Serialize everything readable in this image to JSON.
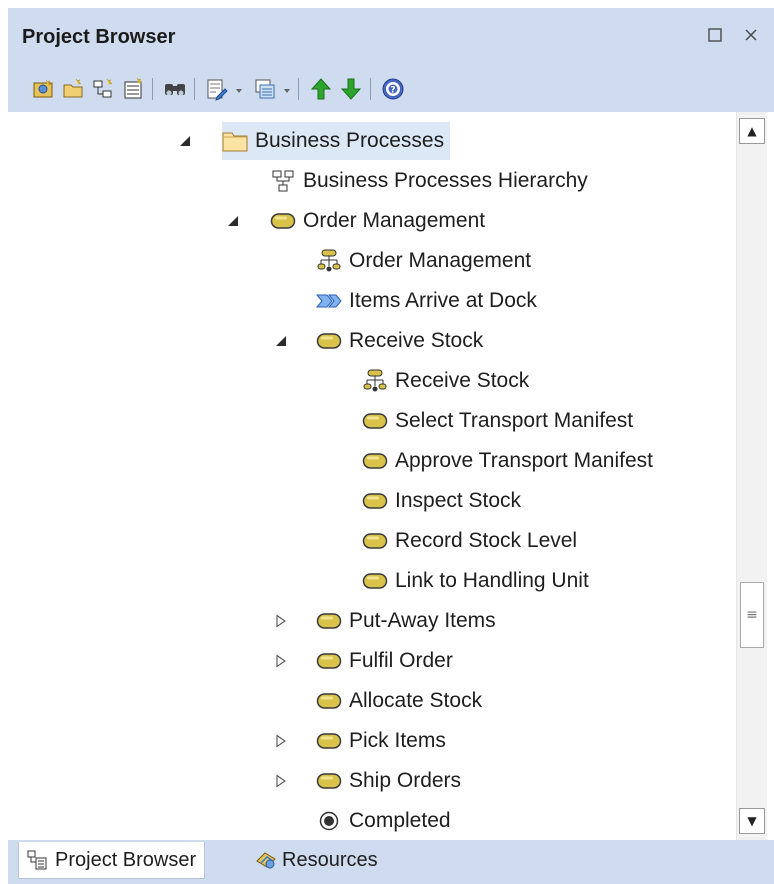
{
  "panel": {
    "title": "Project Browser",
    "buttons": {
      "maximize": "□",
      "close": "×"
    }
  },
  "toolbar": {
    "tools": [
      "new-model-icon",
      "new-package-icon",
      "new-diagram-icon",
      "new-element-icon",
      "find-icon",
      "edit-properties-icon",
      "view-menu-icon",
      "move-up-icon",
      "move-down-icon",
      "help-icon"
    ]
  },
  "tree": {
    "items": [
      {
        "label": "Business Processes",
        "icon": "folder-icon",
        "expander": "expanded",
        "selected": true
      },
      {
        "label": "Business Processes Hierarchy",
        "icon": "hierarchy-diagram-icon",
        "expander": "none"
      },
      {
        "label": "Order Management",
        "icon": "activity-icon",
        "expander": "expanded"
      },
      {
        "label": "Order Management",
        "icon": "activity-diagram-icon",
        "expander": "none"
      },
      {
        "label": "Items Arrive at Dock",
        "icon": "event-icon",
        "expander": "none"
      },
      {
        "label": "Receive Stock",
        "icon": "activity-icon",
        "expander": "expanded"
      },
      {
        "label": "Receive Stock",
        "icon": "activity-diagram-icon",
        "expander": "none"
      },
      {
        "label": "Select Transport Manifest",
        "icon": "activity-icon",
        "expander": "none"
      },
      {
        "label": "Approve Transport Manifest",
        "icon": "activity-icon",
        "expander": "none"
      },
      {
        "label": "Inspect Stock",
        "icon": "activity-icon",
        "expander": "none"
      },
      {
        "label": "Record Stock Level",
        "icon": "activity-icon",
        "expander": "none"
      },
      {
        "label": "Link to Handling Unit",
        "icon": "activity-icon",
        "expander": "none"
      },
      {
        "label": "Put-Away Items",
        "icon": "activity-icon",
        "expander": "collapsed"
      },
      {
        "label": "Fulfil Order",
        "icon": "activity-icon",
        "expander": "collapsed"
      },
      {
        "label": "Allocate Stock",
        "icon": "activity-icon",
        "expander": "none"
      },
      {
        "label": "Pick Items",
        "icon": "activity-icon",
        "expander": "collapsed"
      },
      {
        "label": "Ship Orders",
        "icon": "activity-icon",
        "expander": "collapsed"
      },
      {
        "label": "Completed",
        "icon": "final-node-icon",
        "expander": "none"
      }
    ]
  },
  "scrollbar": {
    "up": "▲",
    "down": "▼",
    "thumb_grip": "≡"
  },
  "tabs": [
    {
      "label": "Project Browser",
      "icon": "project-browser-icon",
      "active": true
    },
    {
      "label": "Resources",
      "icon": "resources-icon",
      "active": false
    }
  ],
  "colors": {
    "frame": "#cfdcef",
    "selected_row": "#dde8f6",
    "activity_fill": "#d8c24a",
    "activity_border": "#3a3a3a"
  }
}
